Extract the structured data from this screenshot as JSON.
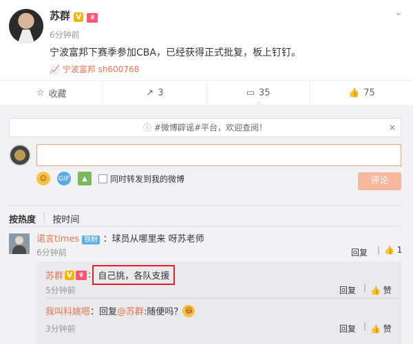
{
  "post": {
    "author": "苏群",
    "time": "6分钟前",
    "text": "宁波富邦下赛季参加CBA，已经获得正式批复，板上钉钉。",
    "stock_tag": "宁波富邦 sh600768"
  },
  "actions": {
    "favorite": "收藏",
    "repost": "3",
    "comment": "35",
    "like": "75"
  },
  "notice": "#微博辟谣#平台，欢迎查阅！",
  "composer": {
    "share_label": "同时转发到我的微博",
    "submit": "评论"
  },
  "tabs": [
    "按热度",
    "按时间"
  ],
  "comments": [
    {
      "user": "诺言times",
      "badge": "铁粉",
      "text": "：球员从哪里来 呀苏老师",
      "time": "6分钟前",
      "reply": "回复",
      "likes": "1"
    }
  ],
  "replies": [
    {
      "user": "苏群",
      "text": "自己挑，各队支援",
      "time": "5分钟前",
      "reply": "回复",
      "like": "赞"
    },
    {
      "user": "我叫科姚嗯",
      "prefix": "：回复",
      "mention": "@苏群",
      "text": ":随便吗？",
      "time": "3分钟前",
      "reply": "回复",
      "like": "赞"
    }
  ],
  "colors": {
    "accent": "#eb7350",
    "bg": "#f2f2f5"
  }
}
